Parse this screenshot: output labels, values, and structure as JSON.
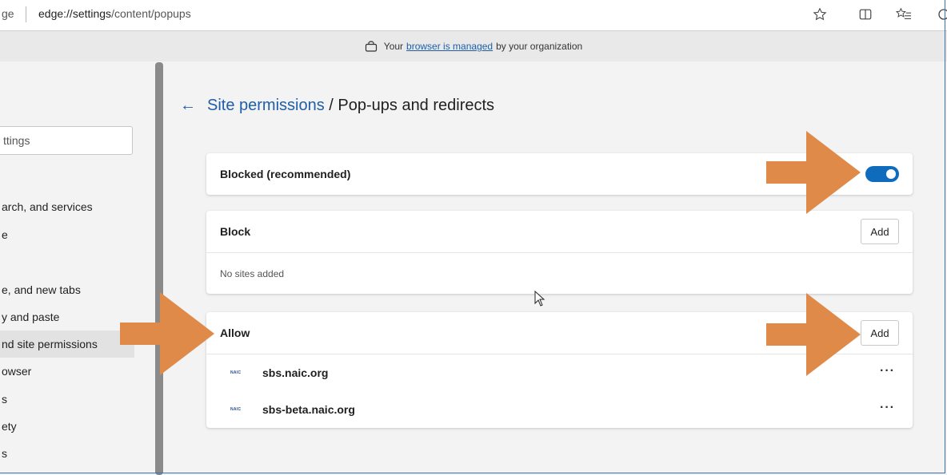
{
  "address_bar": {
    "prefix": "ge",
    "url_host": "edge://settings",
    "url_path": "/content/popups"
  },
  "infobar": {
    "before": "Your",
    "link": "browser is managed",
    "after": "by your organization"
  },
  "sidebar": {
    "search_placeholder": "ttings",
    "items": [
      {
        "label": "arch, and services"
      },
      {
        "label": "e"
      },
      {
        "label": "e, and new tabs"
      },
      {
        "label": "y and paste"
      },
      {
        "label": "nd site permissions"
      },
      {
        "label": "owser"
      },
      {
        "label": "s"
      },
      {
        "label": "ety"
      },
      {
        "label": "s"
      }
    ]
  },
  "page": {
    "breadcrumb": "Site permissions",
    "separator": " / ",
    "title": "Pop-ups and redirects"
  },
  "blocked_card": {
    "label": "Blocked (recommended)",
    "toggle_on": true
  },
  "block_card": {
    "label": "Block",
    "add_label": "Add",
    "empty_text": "No sites added"
  },
  "allow_card": {
    "label": "Allow",
    "add_label": "Add",
    "sites": [
      {
        "favicon_text": "NAIC",
        "name": "sbs.naic.org",
        "more": "···"
      },
      {
        "favicon_text": "NAIC",
        "name": "sbs-beta.naic.org",
        "more": "···"
      }
    ]
  },
  "colors": {
    "accent": "#0f6cbd",
    "link": "#1f5ea8",
    "arrow": "#e08a4a"
  },
  "icons": [
    "lock-icon",
    "back-arrow-icon",
    "favorite-star-icon",
    "split-screen-icon",
    "favorites-icon",
    "profile-icon",
    "more-icon",
    "cursor-icon",
    "arrow-annotation"
  ]
}
